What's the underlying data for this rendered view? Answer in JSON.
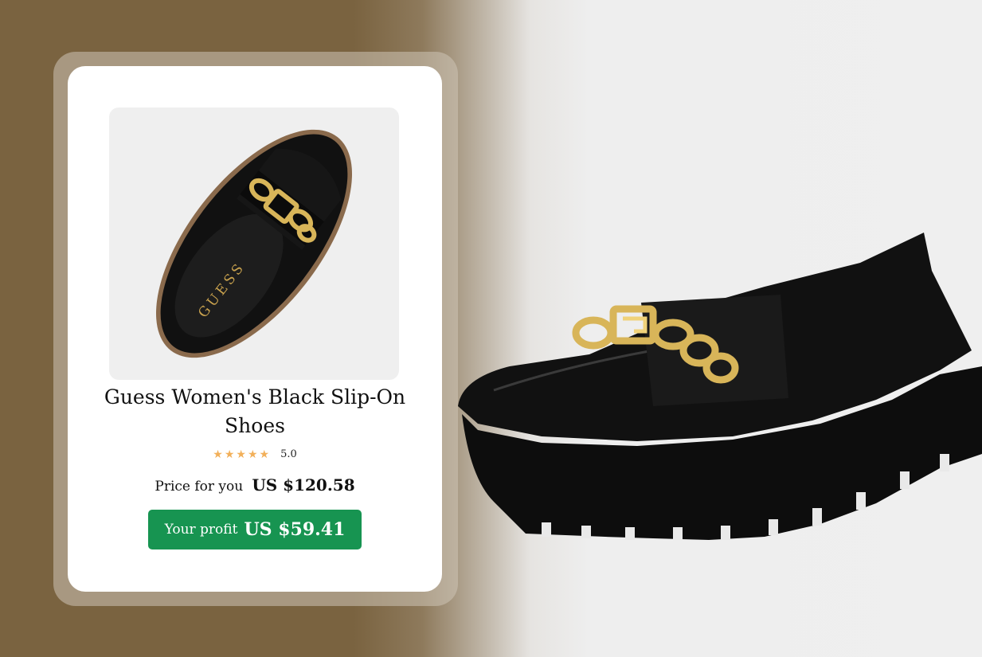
{
  "product": {
    "title": "Guess Women's Black Slip-On Shoes",
    "rating_value": "5.0",
    "rating_stars": 5,
    "insole_brand": "GUESS",
    "price_label": "Price for you",
    "price_value": "US $120.58",
    "profit_label": "Your profit",
    "profit_value": "US $59.41"
  },
  "colors": {
    "background_left": "#7a6340",
    "background_right": "#efefef",
    "accent_green": "#179451",
    "star_color": "#f2b05a"
  },
  "icons": {
    "rating": "star-icon"
  }
}
